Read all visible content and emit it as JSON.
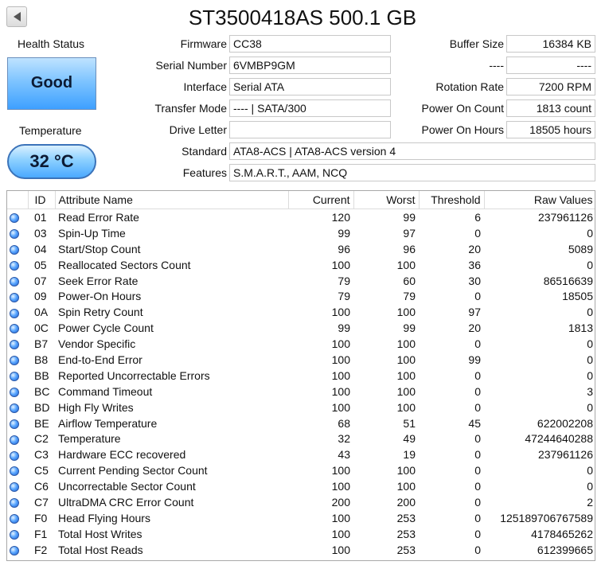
{
  "header": {
    "title": "ST3500418AS 500.1 GB"
  },
  "left": {
    "health_label": "Health Status",
    "health_value": "Good",
    "temperature_label": "Temperature",
    "temperature_value": "32 °C"
  },
  "info": {
    "firmware_label": "Firmware",
    "firmware_value": "CC38",
    "serial_label": "Serial Number",
    "serial_value": "6VMBP9GM",
    "interface_label": "Interface",
    "interface_value": "Serial ATA",
    "transfer_label": "Transfer Mode",
    "transfer_value": "---- | SATA/300",
    "drive_letter_label": "Drive Letter",
    "drive_letter_value": "",
    "standard_label": "Standard",
    "standard_value": "ATA8-ACS | ATA8-ACS version 4",
    "features_label": "Features",
    "features_value": "S.M.A.R.T., AAM, NCQ",
    "buffer_label": "Buffer Size",
    "buffer_value": "16384 KB",
    "blank_label": "----",
    "blank_value": "----",
    "rotation_label": "Rotation Rate",
    "rotation_value": "7200 RPM",
    "power_count_label": "Power On Count",
    "power_count_value": "1813 count",
    "power_hours_label": "Power On Hours",
    "power_hours_value": "18505 hours"
  },
  "smart_table": {
    "columns": [
      "ID",
      "Attribute Name",
      "Current",
      "Worst",
      "Threshold",
      "Raw Values"
    ],
    "status_color": "#3b82f6",
    "rows": [
      [
        "01",
        "Read Error Rate",
        "120",
        "99",
        "6",
        "237961126"
      ],
      [
        "03",
        "Spin-Up Time",
        "99",
        "97",
        "0",
        "0"
      ],
      [
        "04",
        "Start/Stop Count",
        "96",
        "96",
        "20",
        "5089"
      ],
      [
        "05",
        "Reallocated Sectors Count",
        "100",
        "100",
        "36",
        "0"
      ],
      [
        "07",
        "Seek Error Rate",
        "79",
        "60",
        "30",
        "86516639"
      ],
      [
        "09",
        "Power-On Hours",
        "79",
        "79",
        "0",
        "18505"
      ],
      [
        "0A",
        "Spin Retry Count",
        "100",
        "100",
        "97",
        "0"
      ],
      [
        "0C",
        "Power Cycle Count",
        "99",
        "99",
        "20",
        "1813"
      ],
      [
        "B7",
        "Vendor Specific",
        "100",
        "100",
        "0",
        "0"
      ],
      [
        "B8",
        "End-to-End Error",
        "100",
        "100",
        "99",
        "0"
      ],
      [
        "BB",
        "Reported Uncorrectable Errors",
        "100",
        "100",
        "0",
        "0"
      ],
      [
        "BC",
        "Command Timeout",
        "100",
        "100",
        "0",
        "3"
      ],
      [
        "BD",
        "High Fly Writes",
        "100",
        "100",
        "0",
        "0"
      ],
      [
        "BE",
        "Airflow Temperature",
        "68",
        "51",
        "45",
        "622002208"
      ],
      [
        "C2",
        "Temperature",
        "32",
        "49",
        "0",
        "47244640288"
      ],
      [
        "C3",
        "Hardware ECC recovered",
        "43",
        "19",
        "0",
        "237961126"
      ],
      [
        "C5",
        "Current Pending Sector Count",
        "100",
        "100",
        "0",
        "0"
      ],
      [
        "C6",
        "Uncorrectable Sector Count",
        "100",
        "100",
        "0",
        "0"
      ],
      [
        "C7",
        "UltraDMA CRC Error Count",
        "200",
        "200",
        "0",
        "2"
      ],
      [
        "F0",
        "Head Flying Hours",
        "100",
        "253",
        "0",
        "125189706767589"
      ],
      [
        "F1",
        "Total Host Writes",
        "100",
        "253",
        "0",
        "4178465262"
      ],
      [
        "F2",
        "Total Host Reads",
        "100",
        "253",
        "0",
        "612399665"
      ]
    ]
  },
  "icons": {
    "back": "left-arrow-icon",
    "status": "status-dot-icon"
  }
}
